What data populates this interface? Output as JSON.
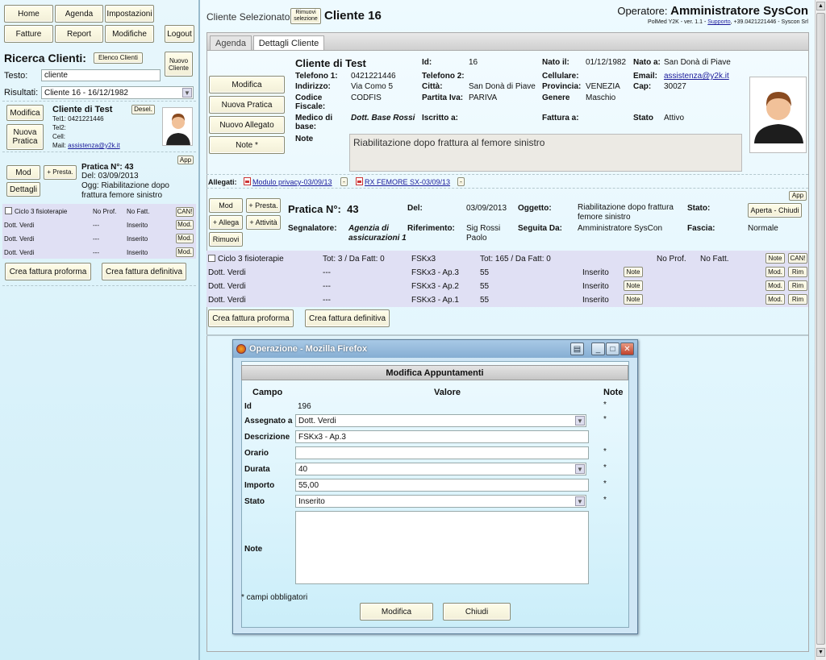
{
  "nav": {
    "home": "Home",
    "agenda": "Agenda",
    "impostazioni": "Impostazioni",
    "fatture": "Fatture",
    "report": "Report",
    "modifiche": "Modifiche",
    "logout": "Logout"
  },
  "search": {
    "title": "Ricerca Clienti:",
    "elenco": "Elenco Clienti",
    "nuovo": "Nuovo Cliente",
    "testo_label": "Testo:",
    "testo_value": "cliente",
    "risultati_label": "Risultati:",
    "risultati_value": "Cliente 16 - 16/12/1982"
  },
  "left_client": {
    "modifica": "Modifica",
    "nuova_pratica": "Nuova Pratica",
    "name": "Cliente di Test",
    "desel": "Desel.",
    "tel1": "Tel1: 0421221446",
    "tel2": "Tel2:",
    "cell": "Cell:",
    "mail_label": "Mail:",
    "mail": "assistenza@y2k.it"
  },
  "left_pratica": {
    "app": "App",
    "mod": "Mod",
    "presta": "+ Presta.",
    "dettagli": "Dettagli",
    "title": "Pratica N°: 43",
    "del": "Del: 03/09/2013",
    "ogg": "Ogg: Riabilitazione dopo",
    "ogg2": "frattura femore sinistro"
  },
  "left_ciclo": {
    "label": "Ciclo 3 fisioterapie",
    "noprof": "No Prof.",
    "nofatt": "No Fatt.",
    "can": "CAN!",
    "rows": [
      {
        "name": "Dott. Verdi",
        "dash": "---",
        "stato": "Inserito",
        "btn": "Mod."
      },
      {
        "name": "Dott. Verdi",
        "dash": "---",
        "stato": "Inserito",
        "btn": "Mod."
      },
      {
        "name": "Dott. Verdi",
        "dash": "---",
        "stato": "Inserito",
        "btn": "Mod."
      }
    ],
    "proforma": "Crea fattura proforma",
    "definitiva": "Crea fattura definitiva"
  },
  "header": {
    "cliente_sel_label": "Cliente Selezionato:",
    "rimuovi": "Rimuovi selezione",
    "cliente_sel": "Cliente 16",
    "operatore_label": "Operatore:",
    "operatore": "Amministratore SysCon",
    "version": "PolMed Y2K - ver. 1.1 -",
    "supporto": "Supporto",
    "version2": ", +39.0421221446 - Syscon Srl"
  },
  "tabs": {
    "agenda": "Agenda",
    "dettagli": "Dettagli Cliente"
  },
  "client": {
    "modifica": "Modifica",
    "nuova_pratica": "Nuova Pratica",
    "nuovo_allegato": "Nuovo Allegato",
    "note_btn": "Note *",
    "name": "Cliente di Test",
    "id_label": "Id:",
    "id": "16",
    "nato_il_label": "Nato il:",
    "nato_il": "01/12/1982",
    "nato_a_label": "Nato a:",
    "nato_a": "San Donà di Piave",
    "tel1_label": "Telefono 1:",
    "tel1": "0421221446",
    "tel2_label": "Telefono 2:",
    "cell_label": "Cellulare:",
    "email_label": "Email:",
    "email": "assistenza@y2k.it",
    "ind_label": "Indirizzo:",
    "ind": "Via Como 5",
    "citta_label": "Città:",
    "citta": "San Donà di Piave",
    "prov_label": "Provincia:",
    "prov": "VENEZIA",
    "cap_label": "Cap:",
    "cap": "30027",
    "cf_label": "Codice",
    "cf_label2": "Fiscale:",
    "cf": "CODFIS",
    "piva_label": "Partita Iva:",
    "piva": "PARIVA",
    "genere_label": "Genere",
    "genere": "Maschio",
    "medico_label": "Medico di",
    "medico_label2": "base:",
    "medico": "Dott. Base Rossi",
    "iscritto_label": "Iscritto a:",
    "fattura_label": "Fattura a:",
    "stato_label": "Stato",
    "stato": "Attivo",
    "note_label": "Note",
    "note": "Riabilitazione dopo frattura al femore sinistro"
  },
  "allegati": {
    "label": "Allegati:",
    "a1": "Modulo privacy-03/09/13",
    "a2": "RX FEMORE SX-03/09/13"
  },
  "pratica": {
    "app": "App",
    "mod": "Mod",
    "presta": "+ Presta.",
    "allega": "+ Allega",
    "attivita": "+ Attività",
    "rimuovi": "Rimuovi",
    "title_label": "Pratica N°:",
    "num": "43",
    "del_label": "Del:",
    "del": "03/09/2013",
    "ogg_label": "Oggetto:",
    "ogg": "Riabilitazione dopo frattura",
    "ogg2": "femore sinistro",
    "stato_label": "Stato:",
    "stato_btn": "Aperta - Chiudi",
    "segn_label": "Segnalatore:",
    "segn": "Agenzia di",
    "segn2": "assicurazioni 1",
    "rif_label": "Riferimento:",
    "rif": "Sig Rossi",
    "rif2": "Paolo",
    "seguita_label": "Seguita Da:",
    "seguita": "Amministratore SysCon",
    "fascia_label": "Fascia:",
    "fascia": "Normale"
  },
  "ciclo": {
    "label": "Ciclo 3 fisioterapie",
    "tot": "Tot: 3 / Da Fatt: 0",
    "code": "FSKx3",
    "tot2": "Tot: 165 / Da Fatt: 0",
    "noprof": "No Prof.",
    "nofatt": "No Fatt.",
    "note": "Note",
    "can": "CAN!",
    "rows": [
      {
        "name": "Dott. Verdi",
        "dash": "---",
        "desc": "FSKx3 - Ap.3",
        "imp": "55",
        "stato": "Inserito",
        "note": "Note",
        "mod": "Mod.",
        "rim": "Rim"
      },
      {
        "name": "Dott. Verdi",
        "dash": "---",
        "desc": "FSKx3 - Ap.2",
        "imp": "55",
        "stato": "Inserito",
        "note": "Note",
        "mod": "Mod.",
        "rim": "Rim"
      },
      {
        "name": "Dott. Verdi",
        "dash": "---",
        "desc": "FSKx3 - Ap.1",
        "imp": "55",
        "stato": "Inserito",
        "note": "Note",
        "mod": "Mod.",
        "rim": "Rim"
      }
    ],
    "proforma": "Crea fattura proforma",
    "definitiva": "Crea fattura definitiva"
  },
  "dialog": {
    "title": "Operazione - Mozilla Firefox",
    "heading": "Modifica Appuntamenti",
    "col_campo": "Campo",
    "col_valore": "Valore",
    "col_note": "Note",
    "star": "*",
    "id_label": "Id",
    "id": "196",
    "assegnato_label": "Assegnato a",
    "assegnato": "Dott. Verdi",
    "descr_label": "Descrizione",
    "descr": "FSKx3 - Ap.3",
    "orario_label": "Orario",
    "orario": "",
    "durata_label": "Durata",
    "durata": "40",
    "importo_label": "Importo",
    "importo": "55,00",
    "stato_label": "Stato",
    "stato": "Inserito",
    "note_label": "Note",
    "note": "",
    "footnote": "* campi obbligatori",
    "modifica": "Modifica",
    "chiudi": "Chiudi"
  }
}
